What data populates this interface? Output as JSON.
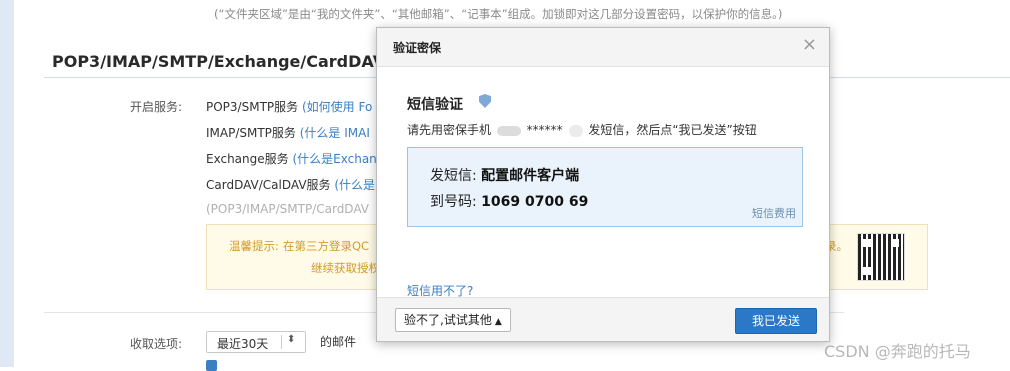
{
  "background": {
    "notice": "(“文件夹区域”是由“我的文件夹”、“其他邮箱”、“记事本”组成。加锁即对这几部分设置密码，以保护你的信息。)",
    "section_title": "POP3/IMAP/SMTP/Exchange/CardDAV/",
    "enable_label": "开启服务:",
    "services": [
      {
        "name": "POP3/SMTP服务",
        "link": "(如何使用 Fo"
      },
      {
        "name": "IMAP/SMTP服务",
        "link": "(什么是 IMAI"
      },
      {
        "name": "Exchange服务",
        "link": "(什么是Exchan"
      },
      {
        "name": "CardDAV/CalDAV服务",
        "link": "(什么是"
      }
    ],
    "services_note": "(POP3/IMAP/SMTP/CardDAV",
    "tip": {
      "label": "温馨提示:",
      "line1": "在第三方登录QC",
      "line2": "继续获取授权码",
      "line1_end": "录。"
    },
    "receive_label": "收取选项:",
    "receive_select": "最近30天",
    "receive_suffix": "的邮件"
  },
  "modal": {
    "title": "验证密保",
    "close_icon": "×",
    "heading": "短信验证",
    "instruction_prefix": "请先用密保手机",
    "instruction_masked": "******",
    "instruction_suffix": "发短信，然后点“我已发送”按钮",
    "sms_label": "发短信:",
    "sms_content": "配置邮件客户端",
    "number_label": "到号码:",
    "number": "1069 0700 69",
    "fee_link": "短信费用",
    "cant_use_link": "短信用不了?",
    "try_other_button": "验不了,试试其他",
    "sent_button": "我已发送"
  },
  "watermark": "CSDN @奔跑的托马",
  "colors": {
    "accent": "#2b78c6",
    "link": "#3a7fc3",
    "tip": "#d49a2a"
  }
}
